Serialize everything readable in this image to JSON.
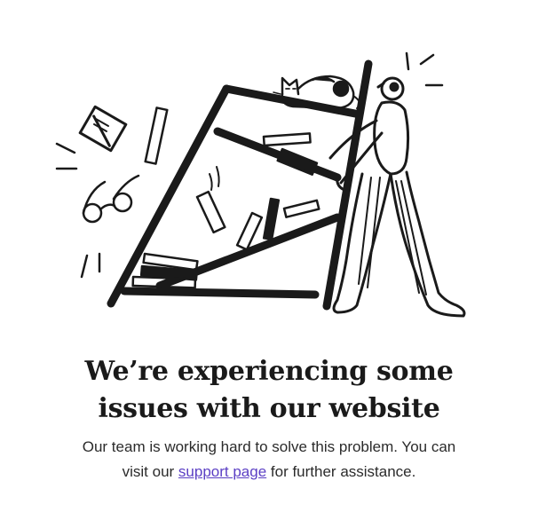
{
  "error": {
    "headline_line1": "We’re experiencing some",
    "headline_line2": "issues with our website",
    "message_line1": "Our team is working hard to solve this problem. You can",
    "message_prefix": "visit our ",
    "support_link_label": "support page",
    "message_suffix": " for further assistance."
  },
  "colors": {
    "ink": "#1a1a1a",
    "link": "#5b3fc4",
    "background": "#ffffff"
  },
  "icons": {
    "illustration": "falling-bookshelf-illustration"
  }
}
